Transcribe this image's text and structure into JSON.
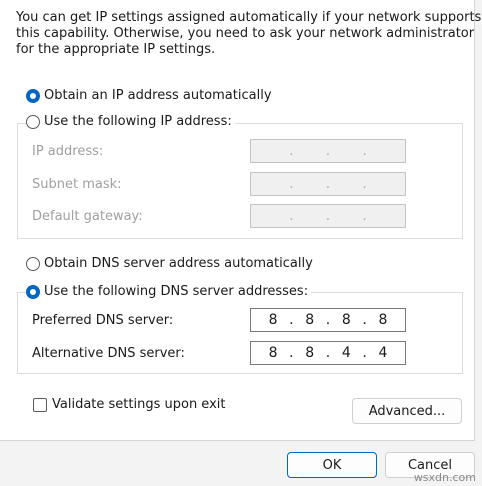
{
  "description": [
    "You can get IP settings assigned automatically if your network supports",
    "this capability. Otherwise, you need to ask your network administrator",
    "for the appropriate IP settings."
  ],
  "ip": {
    "auto_label": "Obtain an IP address automatically",
    "auto_selected": true,
    "manual_label": "Use the following IP address:",
    "manual_selected": false,
    "fields": [
      {
        "label": "IP address:",
        "value": [
          "",
          "",
          "",
          ""
        ]
      },
      {
        "label": "Subnet mask:",
        "value": [
          "",
          "",
          "",
          ""
        ]
      },
      {
        "label": "Default gateway:",
        "value": [
          "",
          "",
          "",
          ""
        ]
      }
    ]
  },
  "dns": {
    "auto_label": "Obtain DNS server address automatically",
    "auto_selected": false,
    "manual_label": "Use the following DNS server addresses:",
    "manual_selected": true,
    "fields": [
      {
        "label": "Preferred DNS server:",
        "value": [
          "8",
          "8",
          "8",
          "8"
        ]
      },
      {
        "label": "Alternative DNS server:",
        "value": [
          "8",
          "8",
          "4",
          "4"
        ]
      }
    ]
  },
  "validate": {
    "label": "Validate settings upon exit",
    "checked": false
  },
  "buttons": {
    "advanced": "Advanced...",
    "ok": "OK",
    "cancel": "Cancel"
  },
  "watermark": "wsxdn.com",
  "colors": {
    "accent": "#0067c0"
  }
}
